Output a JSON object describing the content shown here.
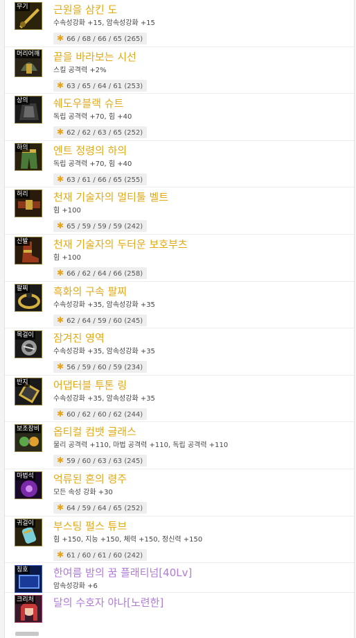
{
  "items": [
    {
      "slot": "무기",
      "name": "근원을 삼킨 도",
      "option": "수속성강화 +15, 암속성강화 +15",
      "stats": "66 / 68 / 66 / 65 (265)",
      "icon": "sword-icon",
      "color": "#e3a915"
    },
    {
      "slot": "머리어깨",
      "name": "끝을 바라보는 시선",
      "option": "스킬 공격력 +2%",
      "stats": "63 / 65 / 64 / 61 (253)",
      "icon": "shoulder-armor-icon",
      "color": "#e3a915"
    },
    {
      "slot": "상의",
      "name": "쉐도우블랙 슈트",
      "option": "독립 공격력 +70, 힘 +40",
      "stats": "62 / 62 / 63 / 65 (252)",
      "icon": "top-armor-icon",
      "color": "#e3a915"
    },
    {
      "slot": "하의",
      "name": "엔트 정령의 하의",
      "option": "독립 공격력 +70, 힘 +40",
      "stats": "63 / 61 / 66 / 65 (255)",
      "icon": "pants-icon",
      "color": "#e3a915"
    },
    {
      "slot": "허리",
      "name": "천재 기술자의 멀티툴 벨트",
      "option": "힘 +100",
      "stats": "65 / 59 / 59 / 59 (242)",
      "icon": "belt-icon",
      "color": "#e3a915"
    },
    {
      "slot": "신발",
      "name": "천재 기술자의 두터운 보호부츠",
      "option": "힘 +100",
      "stats": "66 / 62 / 64 / 66 (258)",
      "icon": "boots-icon",
      "color": "#e3a915"
    },
    {
      "slot": "팔찌",
      "name": "흑화의 구속 팔찌",
      "option": "수속성강화 +35, 암속성강화 +35",
      "stats": "62 / 64 / 59 / 60 (245)",
      "icon": "bracelet-icon",
      "color": "#e3a915"
    },
    {
      "slot": "목걸이",
      "name": "잠겨진 영역",
      "option": "수속성강화 +35, 암속성강화 +35",
      "stats": "56 / 59 / 60 / 59 (234)",
      "icon": "necklace-icon",
      "color": "#e3a915"
    },
    {
      "slot": "반지",
      "name": "어댑터블 투톤 링",
      "option": "수속성강화 +35, 암속성강화 +35",
      "stats": "60 / 62 / 60 / 62 (244)",
      "icon": "ring-icon",
      "color": "#e3a915"
    },
    {
      "slot": "보조장비",
      "name": "옵티컬 컴뱃 글래스",
      "option": "물리 공격력 +110, 마법 공격력 +110, 독립 공격력 +110",
      "stats": "59 / 60 / 63 / 63 (245)",
      "icon": "glasses-icon",
      "color": "#e3a915"
    },
    {
      "slot": "마법석",
      "name": "억류된 혼의 령주",
      "option": "모든 속성 강화 +30",
      "stats": "64 / 59 / 64 / 65 (252)",
      "icon": "magic-stone-icon",
      "color": "#e3a915"
    },
    {
      "slot": "귀걸이",
      "name": "부스팅 펄스 튜브",
      "option": "힘 +150, 지능 +150, 체력 +150, 정신력 +150",
      "stats": "61 / 60 / 61 / 60 (242)",
      "icon": "earring-icon",
      "color": "#e3a915"
    },
    {
      "slot": "칭호",
      "name": "한여름 밤의 꿈 플래티넘[40Lv]",
      "option": "암속성강화 +6",
      "stats": "",
      "icon": "title-icon",
      "color": "#b07ad6"
    },
    {
      "slot": "크리처",
      "name": "달의 수호자 야나[노련한]",
      "option": "",
      "stats": "",
      "icon": "creature-icon",
      "color": "#b07ad6"
    }
  ],
  "colors": {
    "rare_name": "#e3a915",
    "special_name": "#b07ad6",
    "star": "#e8a317"
  }
}
